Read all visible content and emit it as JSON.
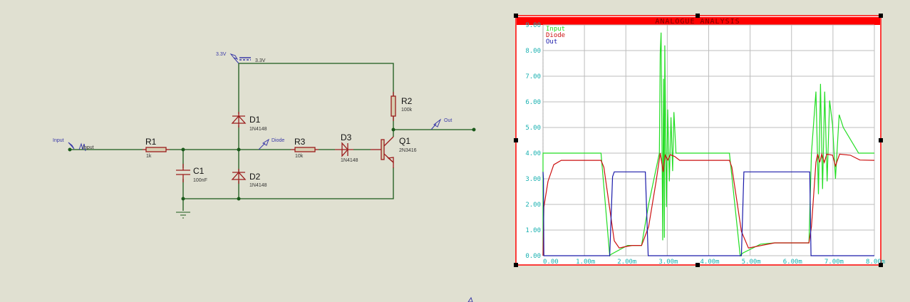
{
  "schematic": {
    "power": {
      "probe_label": "3.3V",
      "terminal_label": "3.3V"
    },
    "input": {
      "probe_label": "Input",
      "generator_label": "Input"
    },
    "components": {
      "R1": {
        "ref": "R1",
        "value": "1k"
      },
      "R2": {
        "ref": "R2",
        "value": "100k"
      },
      "R3": {
        "ref": "R3",
        "value": "10k"
      },
      "C1": {
        "ref": "C1",
        "value": "100nF"
      },
      "D1": {
        "ref": "D1",
        "value": "1N4148"
      },
      "D2": {
        "ref": "D2",
        "value": "1N4148"
      },
      "D3": {
        "ref": "D3",
        "value": "1N4148"
      },
      "Q1": {
        "ref": "Q1",
        "value": "2N3416"
      }
    },
    "probes": {
      "diode": "Diode",
      "out": "Out"
    }
  },
  "colors": {
    "wire": "#1b5a1b",
    "component": "#9b1c1c",
    "probe": "#3a3aa8",
    "graph_frame": "#ff0000"
  },
  "chart_data": {
    "type": "line",
    "title": "ANALOGUE ANALYSIS",
    "xlim": [
      0,
      0.008
    ],
    "ylim": [
      0,
      9
    ],
    "grid": true,
    "legend_position": "top-left",
    "x_ticks": [
      "0.00",
      "1.00m",
      "2.00m",
      "3.00m",
      "4.00m",
      "5.00m",
      "6.00m",
      "7.00m",
      "8.00m"
    ],
    "y_ticks": [
      "0.00",
      "1.00",
      "2.00",
      "3.00",
      "4.00",
      "5.00",
      "6.00",
      "7.00",
      "8.00",
      "9.00"
    ],
    "series": [
      {
        "name": "Input",
        "color": "#22dd22",
        "points_ms": [
          [
            0,
            0
          ],
          [
            0,
            4
          ],
          [
            1.4,
            4
          ],
          [
            1.61,
            0
          ],
          [
            1.64,
            0.05
          ],
          [
            2.04,
            0.4
          ],
          [
            2.38,
            0.4
          ],
          [
            2.55,
            2.0
          ],
          [
            2.81,
            4
          ],
          [
            2.83,
            7.9
          ],
          [
            2.85,
            8.7
          ],
          [
            2.89,
            0.6
          ],
          [
            2.91,
            6.9
          ],
          [
            2.93,
            0.7
          ],
          [
            2.94,
            8.2
          ],
          [
            2.98,
            1.9
          ],
          [
            3.01,
            5.7
          ],
          [
            3.05,
            2.9
          ],
          [
            3.09,
            5.4
          ],
          [
            3.13,
            3.3
          ],
          [
            3.16,
            5.6
          ],
          [
            3.21,
            4.0
          ],
          [
            3.3,
            4
          ],
          [
            4.5,
            4
          ],
          [
            4.76,
            0
          ],
          [
            4.82,
            0.1
          ],
          [
            5.25,
            0.45
          ],
          [
            5.59,
            0.5
          ],
          [
            6.42,
            0.5
          ],
          [
            6.48,
            4
          ],
          [
            6.59,
            6.4
          ],
          [
            6.65,
            2.4
          ],
          [
            6.7,
            6.7
          ],
          [
            6.75,
            2.6
          ],
          [
            6.8,
            6.4
          ],
          [
            6.86,
            2.9
          ],
          [
            6.92,
            6.05
          ],
          [
            6.99,
            5.1
          ],
          [
            7.06,
            3.0
          ],
          [
            7.15,
            5.5
          ],
          [
            7.25,
            5.0
          ],
          [
            7.62,
            4
          ],
          [
            8,
            4
          ]
        ]
      },
      {
        "name": "Diode",
        "color": "#cc1111",
        "points_ms": [
          [
            0,
            0
          ],
          [
            0.02,
            1.9
          ],
          [
            0.12,
            2.9
          ],
          [
            0.26,
            3.55
          ],
          [
            0.44,
            3.72
          ],
          [
            1.4,
            3.72
          ],
          [
            1.47,
            3.45
          ],
          [
            1.64,
            1.5
          ],
          [
            1.72,
            0.58
          ],
          [
            1.84,
            0.3
          ],
          [
            1.98,
            0.35
          ],
          [
            2.15,
            0.4
          ],
          [
            2.38,
            0.4
          ],
          [
            2.55,
            1.13
          ],
          [
            2.73,
            2.9
          ],
          [
            2.83,
            4.0
          ],
          [
            2.9,
            3.27
          ],
          [
            2.95,
            3.92
          ],
          [
            3.01,
            3.73
          ],
          [
            3.07,
            3.94
          ],
          [
            3.18,
            3.87
          ],
          [
            3.3,
            3.72
          ],
          [
            4.5,
            3.72
          ],
          [
            4.56,
            3.45
          ],
          [
            4.79,
            0.95
          ],
          [
            4.96,
            0.3
          ],
          [
            5.59,
            0.5
          ],
          [
            6.42,
            0.5
          ],
          [
            6.48,
            1.13
          ],
          [
            6.59,
            3.64
          ],
          [
            6.63,
            3.96
          ],
          [
            6.68,
            3.64
          ],
          [
            6.73,
            3.96
          ],
          [
            6.79,
            3.64
          ],
          [
            6.85,
            3.96
          ],
          [
            6.99,
            3.92
          ],
          [
            7.06,
            3.5
          ],
          [
            7.16,
            3.96
          ],
          [
            7.42,
            3.92
          ],
          [
            7.65,
            3.73
          ],
          [
            8,
            3.72
          ]
        ]
      },
      {
        "name": "Out",
        "color": "#1a1aaa",
        "points_ms": [
          [
            0,
            3.27
          ],
          [
            0.01,
            3.0
          ],
          [
            0.02,
            0
          ],
          [
            1.61,
            0
          ],
          [
            1.68,
            3.08
          ],
          [
            1.72,
            3.27
          ],
          [
            2.47,
            3.27
          ],
          [
            2.54,
            0
          ],
          [
            4.79,
            0
          ],
          [
            4.85,
            3.27
          ],
          [
            6.44,
            3.27
          ],
          [
            6.47,
            0
          ],
          [
            8,
            0
          ]
        ]
      }
    ]
  }
}
